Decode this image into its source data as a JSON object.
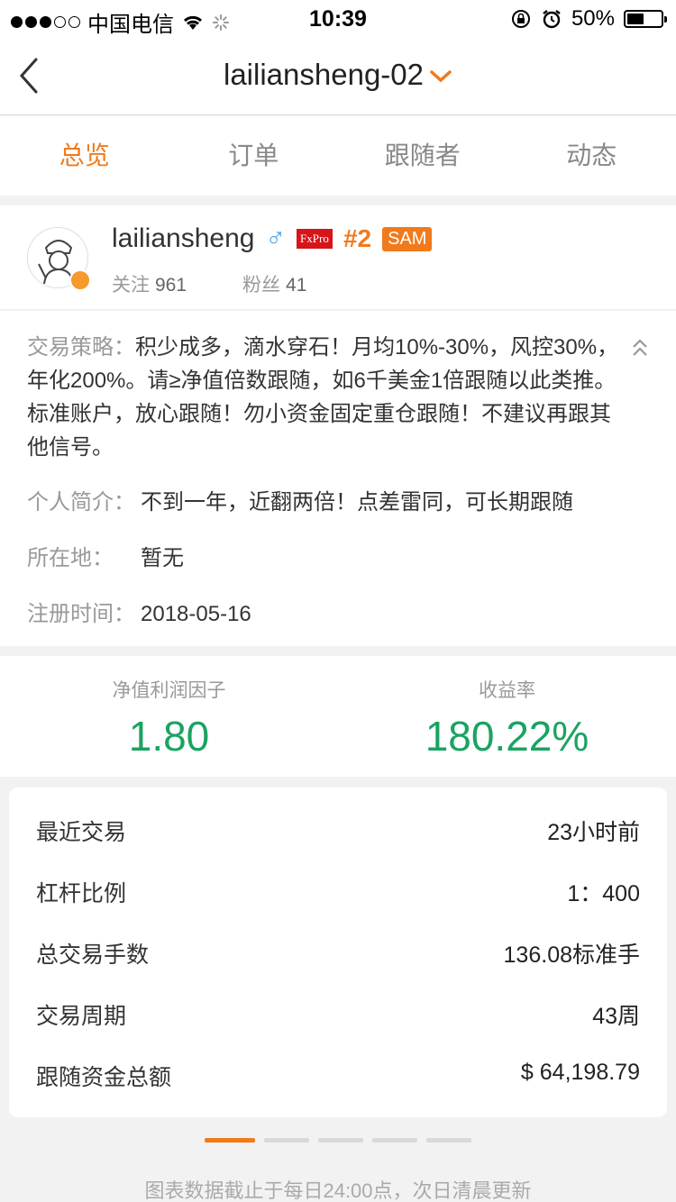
{
  "status_bar": {
    "carrier": "中国电信",
    "time": "10:39",
    "battery": "50%",
    "battery_level": 0.5
  },
  "nav": {
    "title": "lailiansheng-02",
    "back_icon": "back-chevron-icon",
    "dropdown_icon": "chevron-down-icon"
  },
  "tabs": [
    {
      "label": "总览",
      "active": true
    },
    {
      "label": "订单",
      "active": false
    },
    {
      "label": "跟随者",
      "active": false
    },
    {
      "label": "动态",
      "active": false
    }
  ],
  "profile": {
    "username": "lailiansheng",
    "gender_symbol": "♂",
    "broker_logo": "FxPro",
    "rank": "#2",
    "badge": "SAM",
    "follow_label": "关注",
    "follow_count": "961",
    "fans_label": "粉丝",
    "fans_count": "41"
  },
  "info": {
    "strategy_label": "交易策略：",
    "strategy_text": "积少成多，滴水穿石！月均10%-30%，风控30%，年化200%。请≥净值倍数跟随，如6千美金1倍跟随以此类推。标准账户，放心跟随！勿小资金固定重仓跟随！不建议再跟其他信号。",
    "bio_label": "个人简介：",
    "bio_text": "不到一年，近翻两倍！点差雷同，可长期跟随",
    "location_label": "所在地：",
    "location_text": "暂无",
    "register_label": "注册时间：",
    "register_text": "2018-05-16"
  },
  "metrics": [
    {
      "label": "净值利润因子",
      "value": "1.80"
    },
    {
      "label": "收益率",
      "value": "180.22%"
    }
  ],
  "stats": [
    {
      "label": "最近交易",
      "value": "23小时前"
    },
    {
      "label": "杠杆比例",
      "value": "1：400"
    },
    {
      "label": "总交易手数",
      "value": "136.08标准手"
    },
    {
      "label": "交易周期",
      "value": "43周"
    },
    {
      "label": "跟随资金总额",
      "value": "$ 64,198.79"
    }
  ],
  "pager": {
    "count": 5,
    "active_index": 0
  },
  "footnote": "图表数据截止于每日24:00点，次日清晨更新",
  "colors": {
    "accent": "#f07a1c",
    "positive": "#1aa362"
  }
}
